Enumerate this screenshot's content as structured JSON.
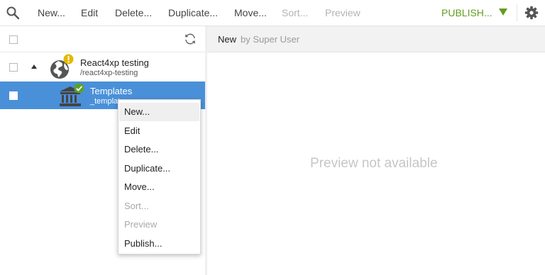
{
  "toolbar": {
    "search_icon": "search-icon",
    "items": [
      {
        "label": "New...",
        "enabled": true
      },
      {
        "label": "Edit",
        "enabled": true
      },
      {
        "label": "Delete...",
        "enabled": true
      },
      {
        "label": "Duplicate...",
        "enabled": true
      },
      {
        "label": "Move...",
        "enabled": true
      },
      {
        "label": "Sort...",
        "enabled": false
      },
      {
        "label": "Preview",
        "enabled": false
      }
    ],
    "publish_label": "PUBLISH...",
    "publish_color": "#609e1f",
    "settings_icon": "gear-icon"
  },
  "tree": {
    "refresh_icon": "refresh-icon",
    "rows": [
      {
        "title": "React4xp testing",
        "path": "/react4xp-testing",
        "icon": "globe-icon",
        "badge": "warning",
        "expanded": true,
        "selected": false
      },
      {
        "title": "Templates",
        "path": "_templates",
        "icon": "templates-building-icon",
        "badge": "check",
        "selected": true
      }
    ]
  },
  "preview": {
    "name": "New",
    "by": "by Super User",
    "message": "Preview not available"
  },
  "context_menu": {
    "items": [
      {
        "label": "New...",
        "enabled": true,
        "hover": true
      },
      {
        "label": "Edit",
        "enabled": true
      },
      {
        "label": "Delete...",
        "enabled": true
      },
      {
        "label": "Duplicate...",
        "enabled": true
      },
      {
        "label": "Move...",
        "enabled": true
      },
      {
        "label": "Sort...",
        "enabled": false
      },
      {
        "label": "Preview",
        "enabled": false
      },
      {
        "label": "Publish...",
        "enabled": true
      }
    ]
  },
  "colors": {
    "selection": "#4a90d9",
    "warning_badge": "#e6b800",
    "check_badge": "#5aa02c"
  }
}
